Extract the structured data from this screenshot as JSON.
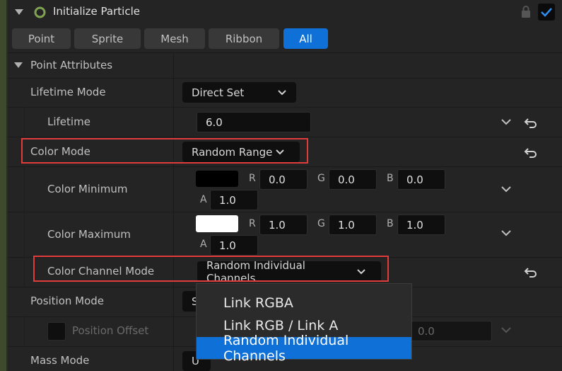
{
  "header": {
    "title": "Initialize Particle"
  },
  "tabs": [
    {
      "label": "Point"
    },
    {
      "label": "Sprite"
    },
    {
      "label": "Mesh"
    },
    {
      "label": "Ribbon"
    },
    {
      "label": "All"
    }
  ],
  "section": {
    "title": "Point Attributes"
  },
  "rows": {
    "lifetime_mode": {
      "label": "Lifetime Mode",
      "value": "Direct Set"
    },
    "lifetime": {
      "label": "Lifetime",
      "value": "6.0"
    },
    "color_mode": {
      "label": "Color Mode",
      "value": "Random Range"
    },
    "color_min": {
      "label": "Color Minimum",
      "r": "0.0",
      "g": "0.0",
      "b": "0.0",
      "a": "1.0",
      "swatch": "#000000"
    },
    "color_max": {
      "label": "Color Maximum",
      "r": "1.0",
      "g": "1.0",
      "b": "1.0",
      "a": "1.0",
      "swatch": "#ffffff"
    },
    "color_channel_mode": {
      "label": "Color Channel Mode",
      "value": "Random Individual Channels"
    },
    "position_mode": {
      "label": "Position Mode",
      "value_partial": "S"
    },
    "position_offset": {
      "label": "Position Offset",
      "value": "0.0"
    },
    "mass_mode": {
      "label": "Mass Mode",
      "value_partial": "U"
    }
  },
  "channels": {
    "r": "R",
    "g": "G",
    "b": "B",
    "a": "A"
  },
  "dropdown_options": [
    {
      "label": "Link RGBA"
    },
    {
      "label": "Link RGB / Link A"
    },
    {
      "label": "Random Individual Channels"
    }
  ],
  "colors": {
    "accent": "#0f70d7",
    "highlight_box": "#e03c3c",
    "module_bar": "#3d4a2c"
  }
}
